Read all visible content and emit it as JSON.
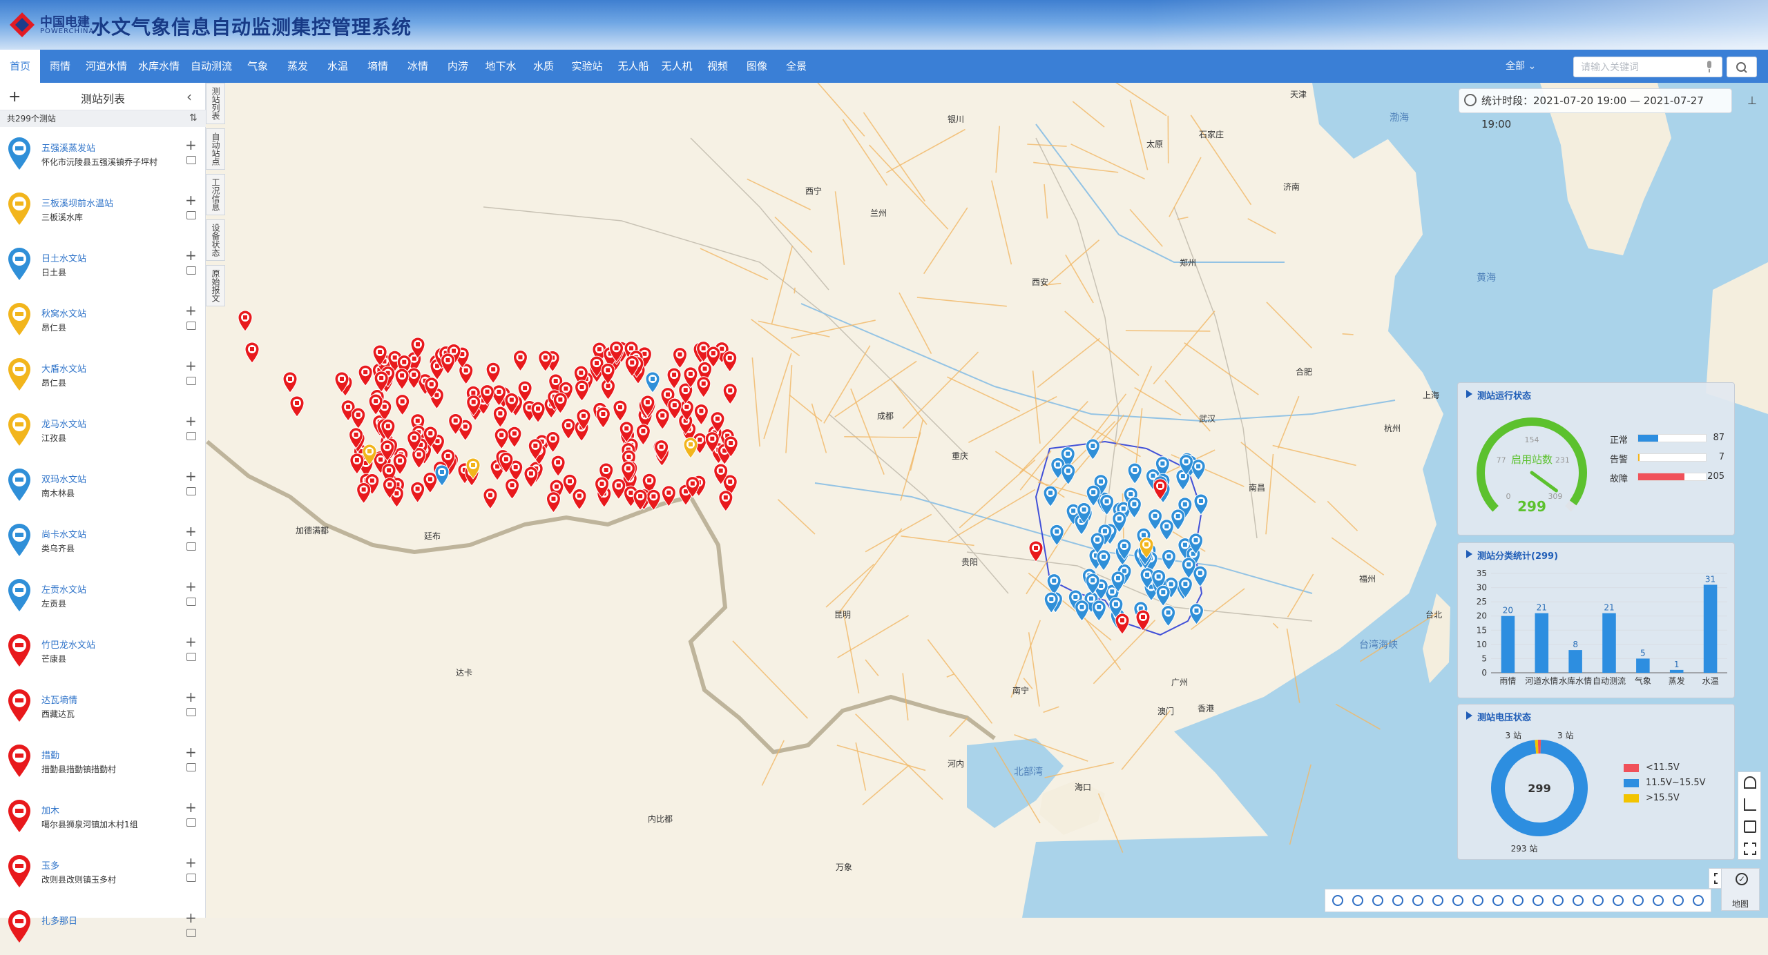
{
  "app": {
    "logo_cn": "中国电建",
    "logo_en": "POWERCHINA",
    "title": "水文气象信息自动监测集控管理系统"
  },
  "nav": {
    "items": [
      "首页",
      "雨情",
      "河道水情",
      "水库水情",
      "自动测流",
      "气象",
      "蒸发",
      "水温",
      "墒情",
      "冰情",
      "内涝",
      "地下水",
      "水质",
      "实验站",
      "无人船",
      "无人机",
      "视频",
      "图像",
      "全景"
    ],
    "active_index": 0,
    "select_value": "全部",
    "search_placeholder": "请输入关键词"
  },
  "sidebar": {
    "title": "测站列表",
    "count_text": "共299个测站",
    "stations": [
      {
        "name": "五强溪蒸发站",
        "addr": "怀化市沅陵县五强溪镇乔子坪村",
        "color": "#2f8fd8"
      },
      {
        "name": "三板溪坝前水温站",
        "addr": "三板溪水库",
        "color": "#f2b51c"
      },
      {
        "name": "日土水文站",
        "addr": "日土县",
        "color": "#2f8fd8"
      },
      {
        "name": "秋窝水文站",
        "addr": "昂仁县",
        "color": "#f2b51c"
      },
      {
        "name": "大盾水文站",
        "addr": "昂仁县",
        "color": "#f2b51c"
      },
      {
        "name": "龙马水文站",
        "addr": "江孜县",
        "color": "#f2b51c"
      },
      {
        "name": "双玛水文站",
        "addr": "南木林县",
        "color": "#2f8fd8"
      },
      {
        "name": "尚卡水文站",
        "addr": "类乌齐县",
        "color": "#2f8fd8"
      },
      {
        "name": "左贡水文站",
        "addr": "左贡县",
        "color": "#2f8fd8"
      },
      {
        "name": "竹巴龙水文站",
        "addr": "芒康县",
        "color": "#e8191c"
      },
      {
        "name": "达瓦墒情",
        "addr": "西藏达瓦",
        "color": "#e8191c"
      },
      {
        "name": "措勤",
        "addr": "措勤县措勤镇措勤村",
        "color": "#e8191c"
      },
      {
        "name": "加木",
        "addr": "噶尔县狮泉河镇加木村1组",
        "color": "#e8191c"
      },
      {
        "name": "玉多",
        "addr": "改则县改则镇玉多村",
        "color": "#e8191c"
      },
      {
        "name": "扎多那日",
        "addr": "",
        "color": "#e8191c"
      }
    ]
  },
  "vtabs": [
    "测站列表",
    "自动站点",
    "工况信息",
    "设备状态",
    "原始报文"
  ],
  "time": {
    "label": "统计时段：",
    "range": "2021-07-20 19:00 — 2021-07-27 19:00"
  },
  "status_panel": {
    "title": "测站运行状态",
    "gauge_center_label": "启用站数",
    "gauge_value": 299,
    "gauge_max": 309,
    "gauge_ticks": [
      "0",
      "77",
      "154",
      "231",
      "309"
    ],
    "rows": [
      {
        "label": "正常",
        "value": 87,
        "color": "#2d8ee0"
      },
      {
        "label": "告警",
        "value": 7,
        "color": "#f2b51c"
      },
      {
        "label": "故障",
        "value": 205,
        "color": "#f0515a"
      }
    ]
  },
  "category_panel": {
    "title": "测站分类统计(299)"
  },
  "voltage_panel": {
    "title": "测站电压状态",
    "center_label": "299",
    "label_left": "3 站",
    "label_right": "3 站",
    "label_bottom": "293 站",
    "legend": [
      {
        "label": "<11.5V",
        "color": "#f0515a"
      },
      {
        "label": "11.5V~15.5V",
        "color": "#2d8ee0"
      },
      {
        "label": ">15.5V",
        "color": "#f2c400"
      }
    ]
  },
  "chart_data": {
    "type": "bar",
    "title": "测站分类统计(299)",
    "categories": [
      "雨情",
      "河道水情",
      "水库水情",
      "自动测流",
      "气象",
      "蒸发",
      "水温"
    ],
    "values": [
      20,
      21,
      8,
      21,
      5,
      1,
      31
    ],
    "ylim": [
      0,
      35
    ],
    "yticks": [
      0,
      5,
      10,
      15,
      20,
      25,
      30,
      35
    ],
    "color": "#2d8ee0"
  },
  "donut_data": {
    "type": "pie",
    "values": [
      3,
      293,
      3
    ],
    "labels": [
      "<11.5V",
      "11.5V~15.5V",
      ">15.5V"
    ],
    "colors": [
      "#f0515a",
      "#2d8ee0",
      "#f2c400"
    ]
  },
  "map": {
    "basemap_label": "地图",
    "labels": [
      {
        "t": "天津",
        "x": 1868,
        "y": 128,
        "cls": ""
      },
      {
        "t": "渤海",
        "x": 2012,
        "y": 160,
        "cls": "sea"
      },
      {
        "t": "银川",
        "x": 1372,
        "y": 164,
        "cls": ""
      },
      {
        "t": "太原",
        "x": 1660,
        "y": 200,
        "cls": ""
      },
      {
        "t": "石家庄",
        "x": 1736,
        "y": 186,
        "cls": ""
      },
      {
        "t": "济南",
        "x": 1858,
        "y": 262,
        "cls": ""
      },
      {
        "t": "西宁",
        "x": 1166,
        "y": 268,
        "cls": ""
      },
      {
        "t": "兰州",
        "x": 1260,
        "y": 300,
        "cls": ""
      },
      {
        "t": "郑州",
        "x": 1708,
        "y": 372,
        "cls": ""
      },
      {
        "t": "西安",
        "x": 1494,
        "y": 400,
        "cls": ""
      },
      {
        "t": "黄海",
        "x": 2138,
        "y": 392,
        "cls": "sea"
      },
      {
        "t": "合肥",
        "x": 1876,
        "y": 530,
        "cls": ""
      },
      {
        "t": "上海",
        "x": 2060,
        "y": 564,
        "cls": ""
      },
      {
        "t": "成都",
        "x": 1270,
        "y": 594,
        "cls": ""
      },
      {
        "t": "武汉",
        "x": 1736,
        "y": 598,
        "cls": ""
      },
      {
        "t": "杭州",
        "x": 2004,
        "y": 612,
        "cls": ""
      },
      {
        "t": "重庆",
        "x": 1378,
        "y": 652,
        "cls": ""
      },
      {
        "t": "南昌",
        "x": 1808,
        "y": 698,
        "cls": ""
      },
      {
        "t": "贵阳",
        "x": 1392,
        "y": 806,
        "cls": ""
      },
      {
        "t": "福州",
        "x": 1968,
        "y": 830,
        "cls": ""
      },
      {
        "t": "昆明",
        "x": 1208,
        "y": 882,
        "cls": ""
      },
      {
        "t": "台北",
        "x": 2064,
        "y": 882,
        "cls": ""
      },
      {
        "t": "台湾海峡",
        "x": 1968,
        "y": 924,
        "cls": "sea"
      },
      {
        "t": "广州",
        "x": 1696,
        "y": 980,
        "cls": ""
      },
      {
        "t": "南宁",
        "x": 1466,
        "y": 992,
        "cls": ""
      },
      {
        "t": "澳门",
        "x": 1676,
        "y": 1022,
        "cls": ""
      },
      {
        "t": "香港",
        "x": 1734,
        "y": 1018,
        "cls": ""
      },
      {
        "t": "河内",
        "x": 1372,
        "y": 1098,
        "cls": ""
      },
      {
        "t": "北部湾",
        "x": 1468,
        "y": 1108,
        "cls": "sea"
      },
      {
        "t": "海口",
        "x": 1556,
        "y": 1132,
        "cls": ""
      },
      {
        "t": "加德满都",
        "x": 428,
        "y": 760,
        "cls": ""
      },
      {
        "t": "廷布",
        "x": 614,
        "y": 768,
        "cls": ""
      },
      {
        "t": "达卡",
        "x": 660,
        "y": 966,
        "cls": ""
      },
      {
        "t": "内比都",
        "x": 938,
        "y": 1178,
        "cls": ""
      },
      {
        "t": "万象",
        "x": 1210,
        "y": 1248,
        "cls": ""
      }
    ]
  }
}
